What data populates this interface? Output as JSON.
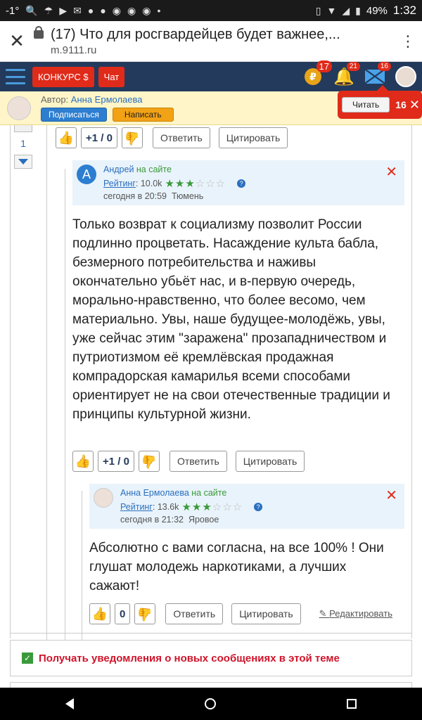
{
  "status_bar": {
    "temperature": "-1°",
    "battery": "49%",
    "time": "1:32"
  },
  "browser": {
    "page_title": "(17) Что для росгвардейцев будет важнее,...",
    "url": "m.9111.ru"
  },
  "header": {
    "contest_label": "КОНКУРС $",
    "chat_label": "Чат",
    "coins_badge": "17",
    "coin_symbol": "₽",
    "notifications_badge": "21",
    "messages_badge": "16"
  },
  "author_bar": {
    "author_prefix": "Автор:",
    "author_name": "Анна Ермолаева",
    "subscribe_label": "Подписаться",
    "write_label": "Написать"
  },
  "read_popup": {
    "read_label": "Читать",
    "count": "16"
  },
  "top_vote": {
    "count": "1"
  },
  "actions_top": {
    "score": "+1 / 0",
    "reply_label": "Ответить",
    "quote_label": "Цитировать"
  },
  "comments": [
    {
      "avatar_letter": "А",
      "author": "Андрей",
      "online": "на сайте",
      "rating_label": "Рейтинг",
      "rating_value": ": 10.0k",
      "stars_on": "★★★",
      "stars_off": "☆☆☆",
      "date": "сегодня в 20:59",
      "location": "Тюмень",
      "text": "Только возврат к социализму позволит России подлинно процветать. Насаждение культа бабла, безмерного потребительства и наживы окончательно убьёт нас, и в-первую очередь, морально-нравственно, что более весомо, чем материально. Увы, наше будущее-молодёжь, увы, уже сейчас этим \"заражена\" прозападничеством и путриотизмом её кремлёвская продажная компрадорская камарилья всеми способами ориентирует не на свои отечественные традиции и принципы культурной жизни.",
      "score": "+1 / 0",
      "reply_label": "Ответить",
      "quote_label": "Цитировать"
    },
    {
      "author": "Анна Ермолаева",
      "online": "на сайте",
      "rating_label": "Рейтинг",
      "rating_value": ": 13.6k",
      "stars_on": "★★★",
      "stars_off": "☆☆☆",
      "date": "сегодня в 21:32",
      "location": "Яровое",
      "text": "Абсолютно с вами согласна, на все 100% ! Они глушат молодежь наркотиками, а лучших сажают!",
      "score": "0",
      "reply_label": "Ответить",
      "quote_label": "Цитировать",
      "edit_label": "Редактировать"
    }
  ],
  "notify": {
    "text": "Получать уведомления о новых сообщениях в этой теме"
  }
}
